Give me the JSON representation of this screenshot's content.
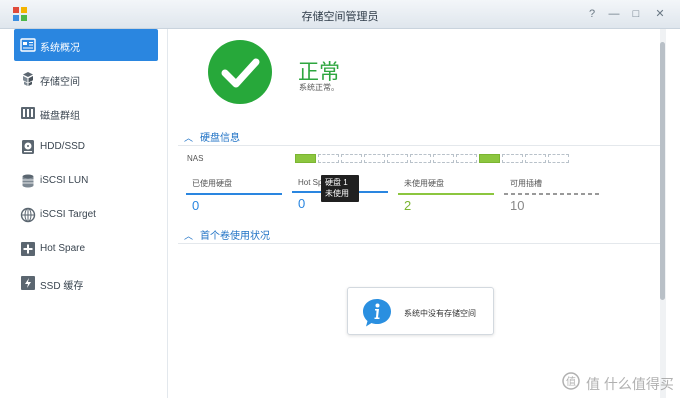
{
  "window": {
    "title": "存储空间管理员",
    "help_symbol": "?",
    "minimize_symbol": "—",
    "maximize_symbol": "□",
    "close_symbol": "✕"
  },
  "sidebar": {
    "items": [
      {
        "label": "系统概况",
        "icon": "overview-icon",
        "active": true
      },
      {
        "label": "存储空间",
        "icon": "storage-space-icon",
        "active": false
      },
      {
        "label": "磁盘群组",
        "icon": "disk-group-icon",
        "active": false
      },
      {
        "label": "HDD/SSD",
        "icon": "hdd-icon",
        "active": false
      },
      {
        "label": "iSCSI LUN",
        "icon": "iscsi-lun-icon",
        "active": false
      },
      {
        "label": "iSCSI Target",
        "icon": "iscsi-target-icon",
        "active": false
      },
      {
        "label": "Hot Spare",
        "icon": "hot-spare-icon",
        "active": false
      },
      {
        "label": "SSD 缓存",
        "icon": "ssd-cache-icon",
        "active": false
      }
    ]
  },
  "status": {
    "title": "正常",
    "description": "系统正常。"
  },
  "disk_info": {
    "header": "硬盘信息",
    "device_label": "NAS",
    "slots_used": [
      true,
      false,
      false,
      false,
      false,
      false,
      false,
      false,
      true,
      false,
      false,
      false
    ],
    "stats": [
      {
        "label": "已使用硬盘",
        "value": "0",
        "color": "#2a86e0"
      },
      {
        "label": "Hot Spare",
        "value": "0",
        "color": "#2a86e0"
      },
      {
        "label": "未使用硬盘",
        "value": "2",
        "color": "#8cc63f"
      },
      {
        "label": "可用插槽",
        "value": "10",
        "color": "#999999"
      }
    ],
    "tooltip": {
      "title": "硬盘 1",
      "status": "未使用"
    }
  },
  "volume_usage": {
    "header": "首个卷使用状况",
    "empty_message": "系统中没有存储空间"
  },
  "watermark": {
    "text": "值 什么值得买"
  },
  "colors": {
    "accent": "#2a86e0",
    "ok_green": "#27a83a",
    "disk_green": "#8cc63f"
  }
}
